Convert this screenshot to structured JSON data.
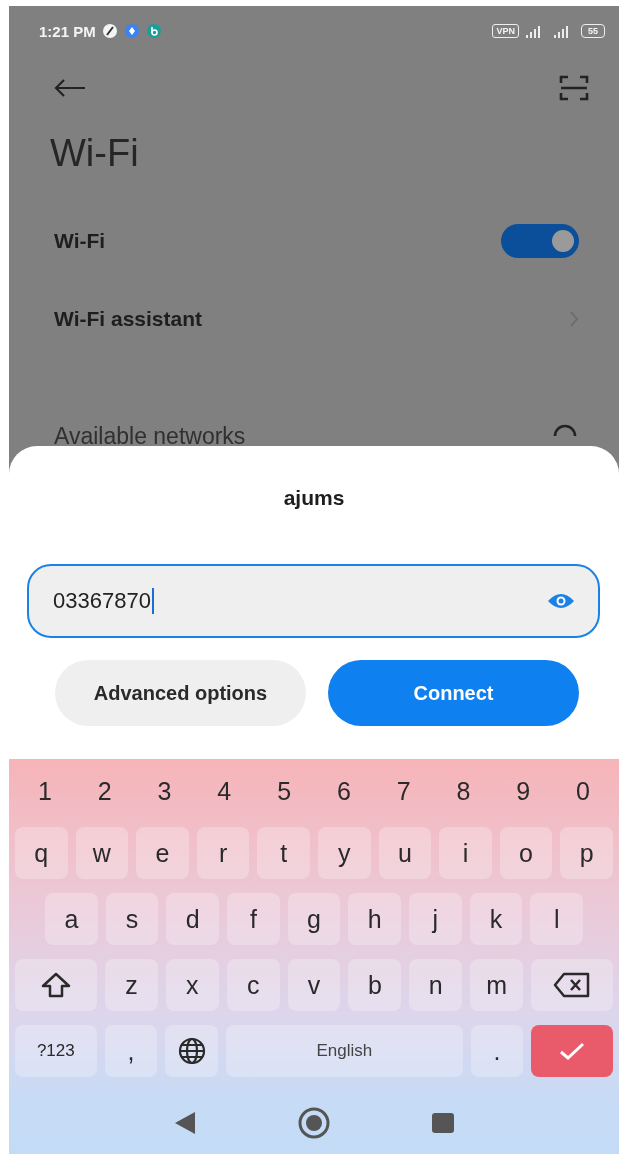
{
  "status_bar": {
    "time": "1:21 PM",
    "vpn_label": "VPN",
    "battery": "55"
  },
  "page": {
    "title": "Wi-Fi",
    "settings": [
      {
        "kind": "toggle",
        "label": "Wi-Fi",
        "on": true
      },
      {
        "kind": "link",
        "label": "Wi-Fi assistant"
      }
    ],
    "section_header": "Available networks"
  },
  "dialog": {
    "title": "ajums",
    "password": {
      "value": "03367870"
    },
    "buttons": [
      {
        "kind": "secondary",
        "label": "Advanced options"
      },
      {
        "kind": "primary",
        "label": "Connect"
      }
    ]
  },
  "keyboard": {
    "number_row": [
      "1",
      "2",
      "3",
      "4",
      "5",
      "6",
      "7",
      "8",
      "9",
      "0"
    ],
    "rows": [
      {
        "keys": [
          {
            "kind": "char",
            "label": "q"
          },
          {
            "kind": "char",
            "label": "w"
          },
          {
            "kind": "char",
            "label": "e"
          },
          {
            "kind": "char",
            "label": "r"
          },
          {
            "kind": "char",
            "label": "t"
          },
          {
            "kind": "char",
            "label": "y"
          },
          {
            "kind": "char",
            "label": "u"
          },
          {
            "kind": "char",
            "label": "i"
          },
          {
            "kind": "char",
            "label": "o"
          },
          {
            "kind": "char",
            "label": "p"
          }
        ]
      },
      {
        "keys": [
          {
            "kind": "char",
            "label": "a"
          },
          {
            "kind": "char",
            "label": "s"
          },
          {
            "kind": "char",
            "label": "d"
          },
          {
            "kind": "char",
            "label": "f"
          },
          {
            "kind": "char",
            "label": "g"
          },
          {
            "kind": "char",
            "label": "h"
          },
          {
            "kind": "char",
            "label": "j"
          },
          {
            "kind": "char",
            "label": "k"
          },
          {
            "kind": "char",
            "label": "l"
          }
        ]
      },
      {
        "keys": [
          {
            "kind": "shift"
          },
          {
            "kind": "char",
            "label": "z"
          },
          {
            "kind": "char",
            "label": "x"
          },
          {
            "kind": "char",
            "label": "c"
          },
          {
            "kind": "char",
            "label": "v"
          },
          {
            "kind": "char",
            "label": "b"
          },
          {
            "kind": "char",
            "label": "n"
          },
          {
            "kind": "char",
            "label": "m"
          },
          {
            "kind": "backspace"
          }
        ]
      },
      {
        "keys": [
          {
            "kind": "mode",
            "label": "?123"
          },
          {
            "kind": "char",
            "label": ","
          },
          {
            "kind": "globe"
          },
          {
            "kind": "space",
            "label": "English"
          },
          {
            "kind": "char",
            "label": "."
          },
          {
            "kind": "enter"
          }
        ]
      }
    ]
  }
}
